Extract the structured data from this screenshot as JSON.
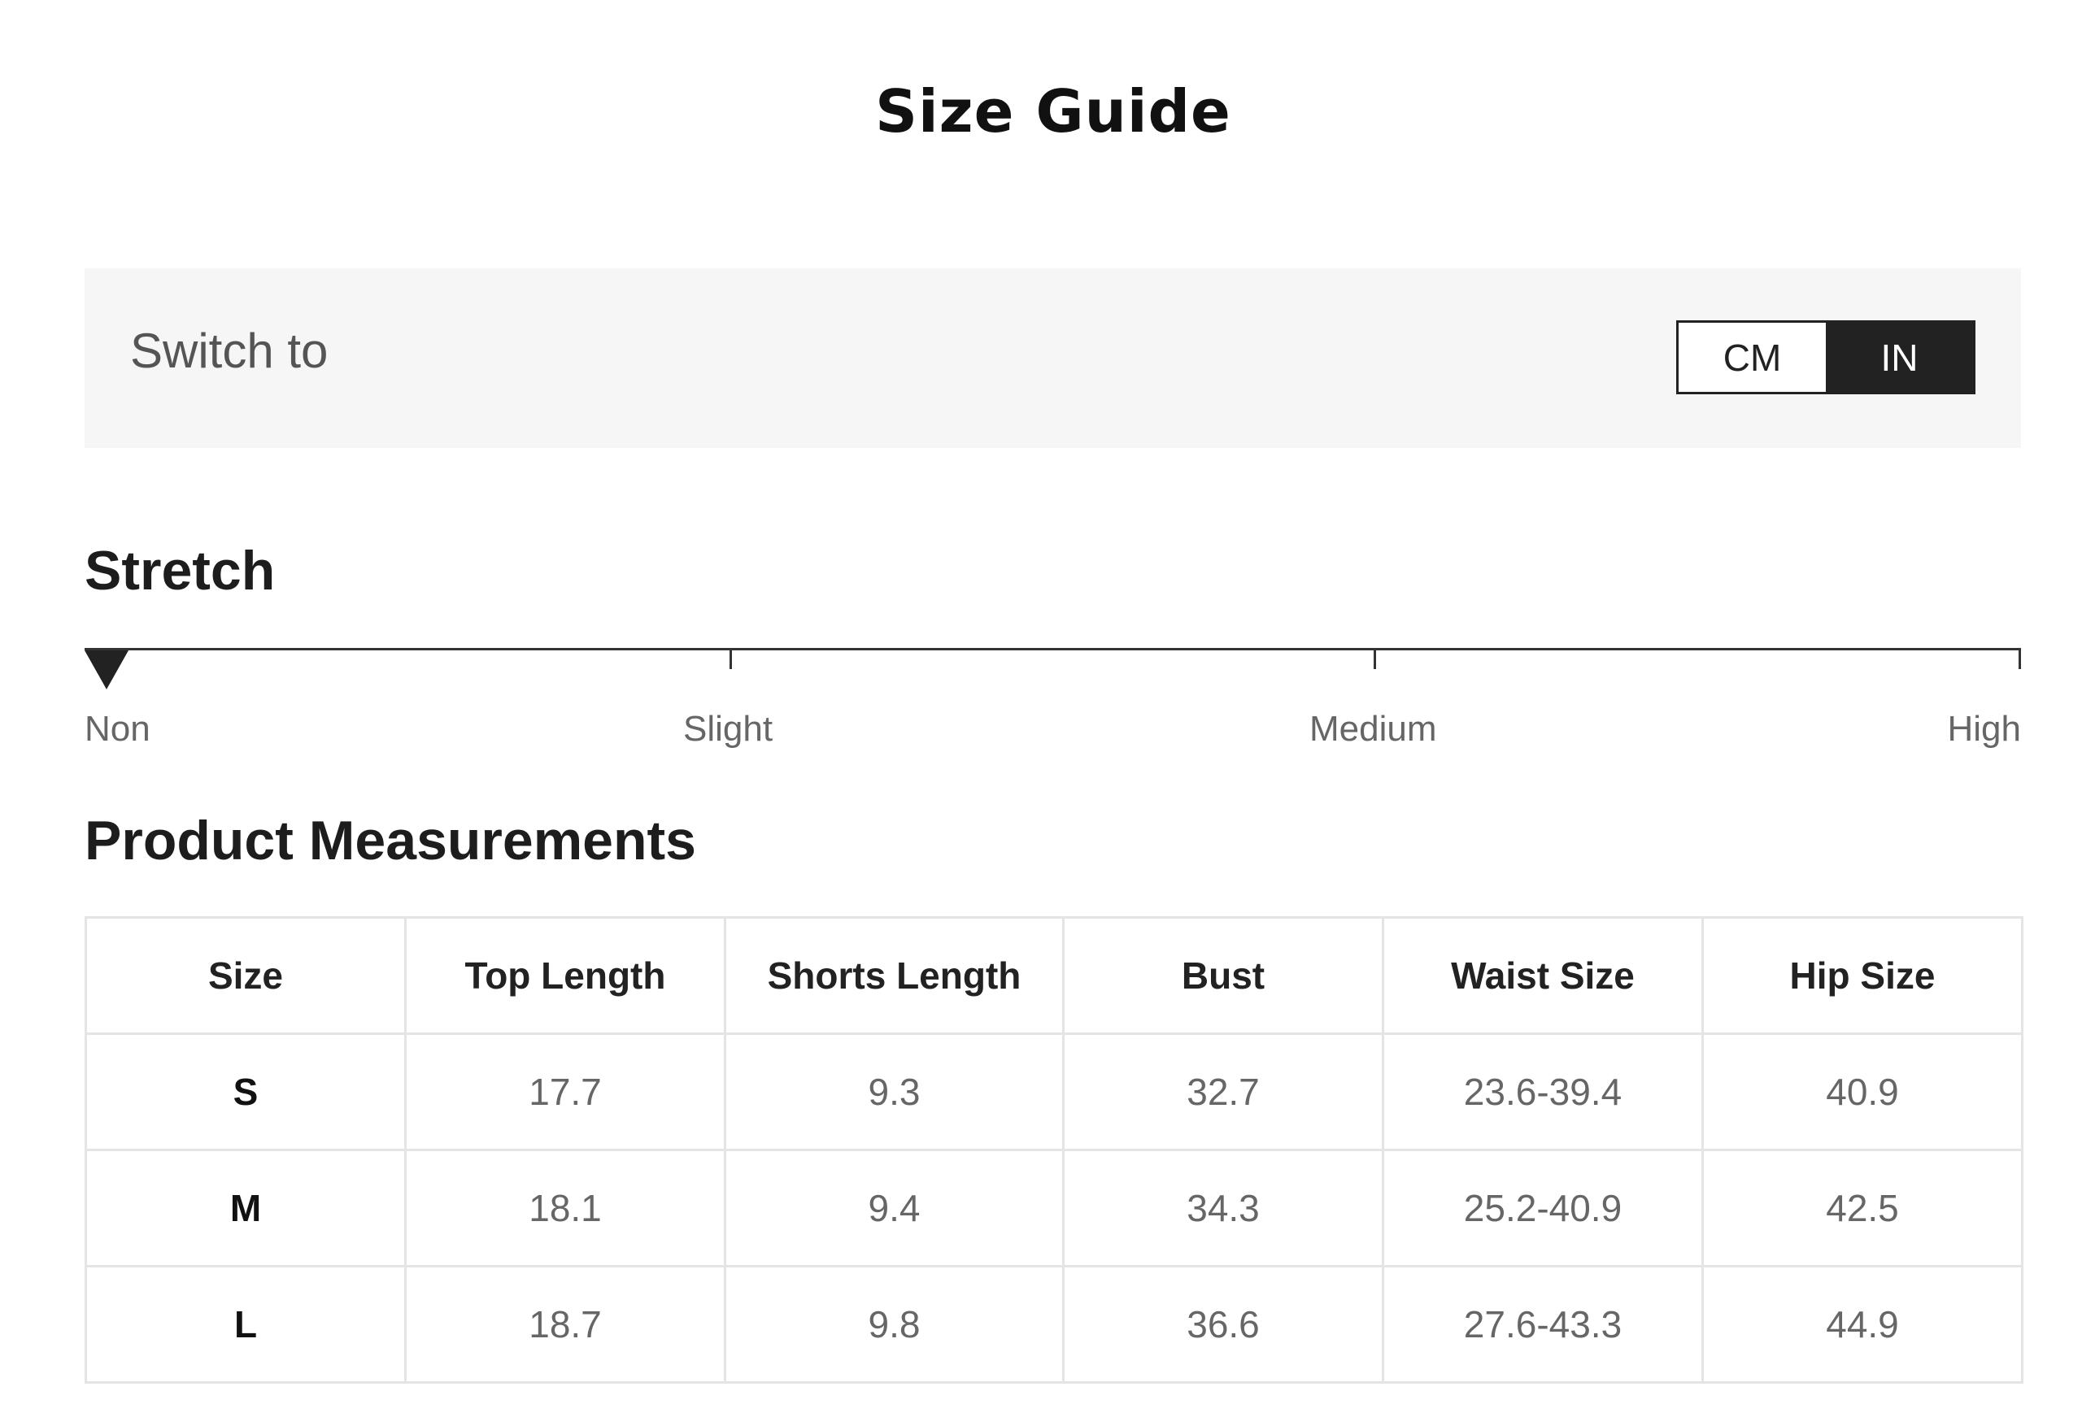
{
  "page": {
    "title": "Size Guide"
  },
  "unit_switch": {
    "label": "Switch to",
    "options": [
      "CM",
      "IN"
    ],
    "selected": "IN"
  },
  "stretch": {
    "heading": "Stretch",
    "levels": [
      "Non",
      "Slight",
      "Medium",
      "High"
    ],
    "selected_level": "Non"
  },
  "measurements": {
    "heading": "Product Measurements",
    "columns": [
      "Size",
      "Top Length",
      "Shorts Length",
      "Bust",
      "Waist Size",
      "Hip Size"
    ],
    "rows": [
      [
        "S",
        "17.7",
        "9.3",
        "32.7",
        "23.6-39.4",
        "40.9"
      ],
      [
        "M",
        "18.1",
        "9.4",
        "34.3",
        "25.2-40.9",
        "42.5"
      ],
      [
        "L",
        "18.7",
        "9.8",
        "36.6",
        "27.6-43.3",
        "44.9"
      ]
    ]
  }
}
